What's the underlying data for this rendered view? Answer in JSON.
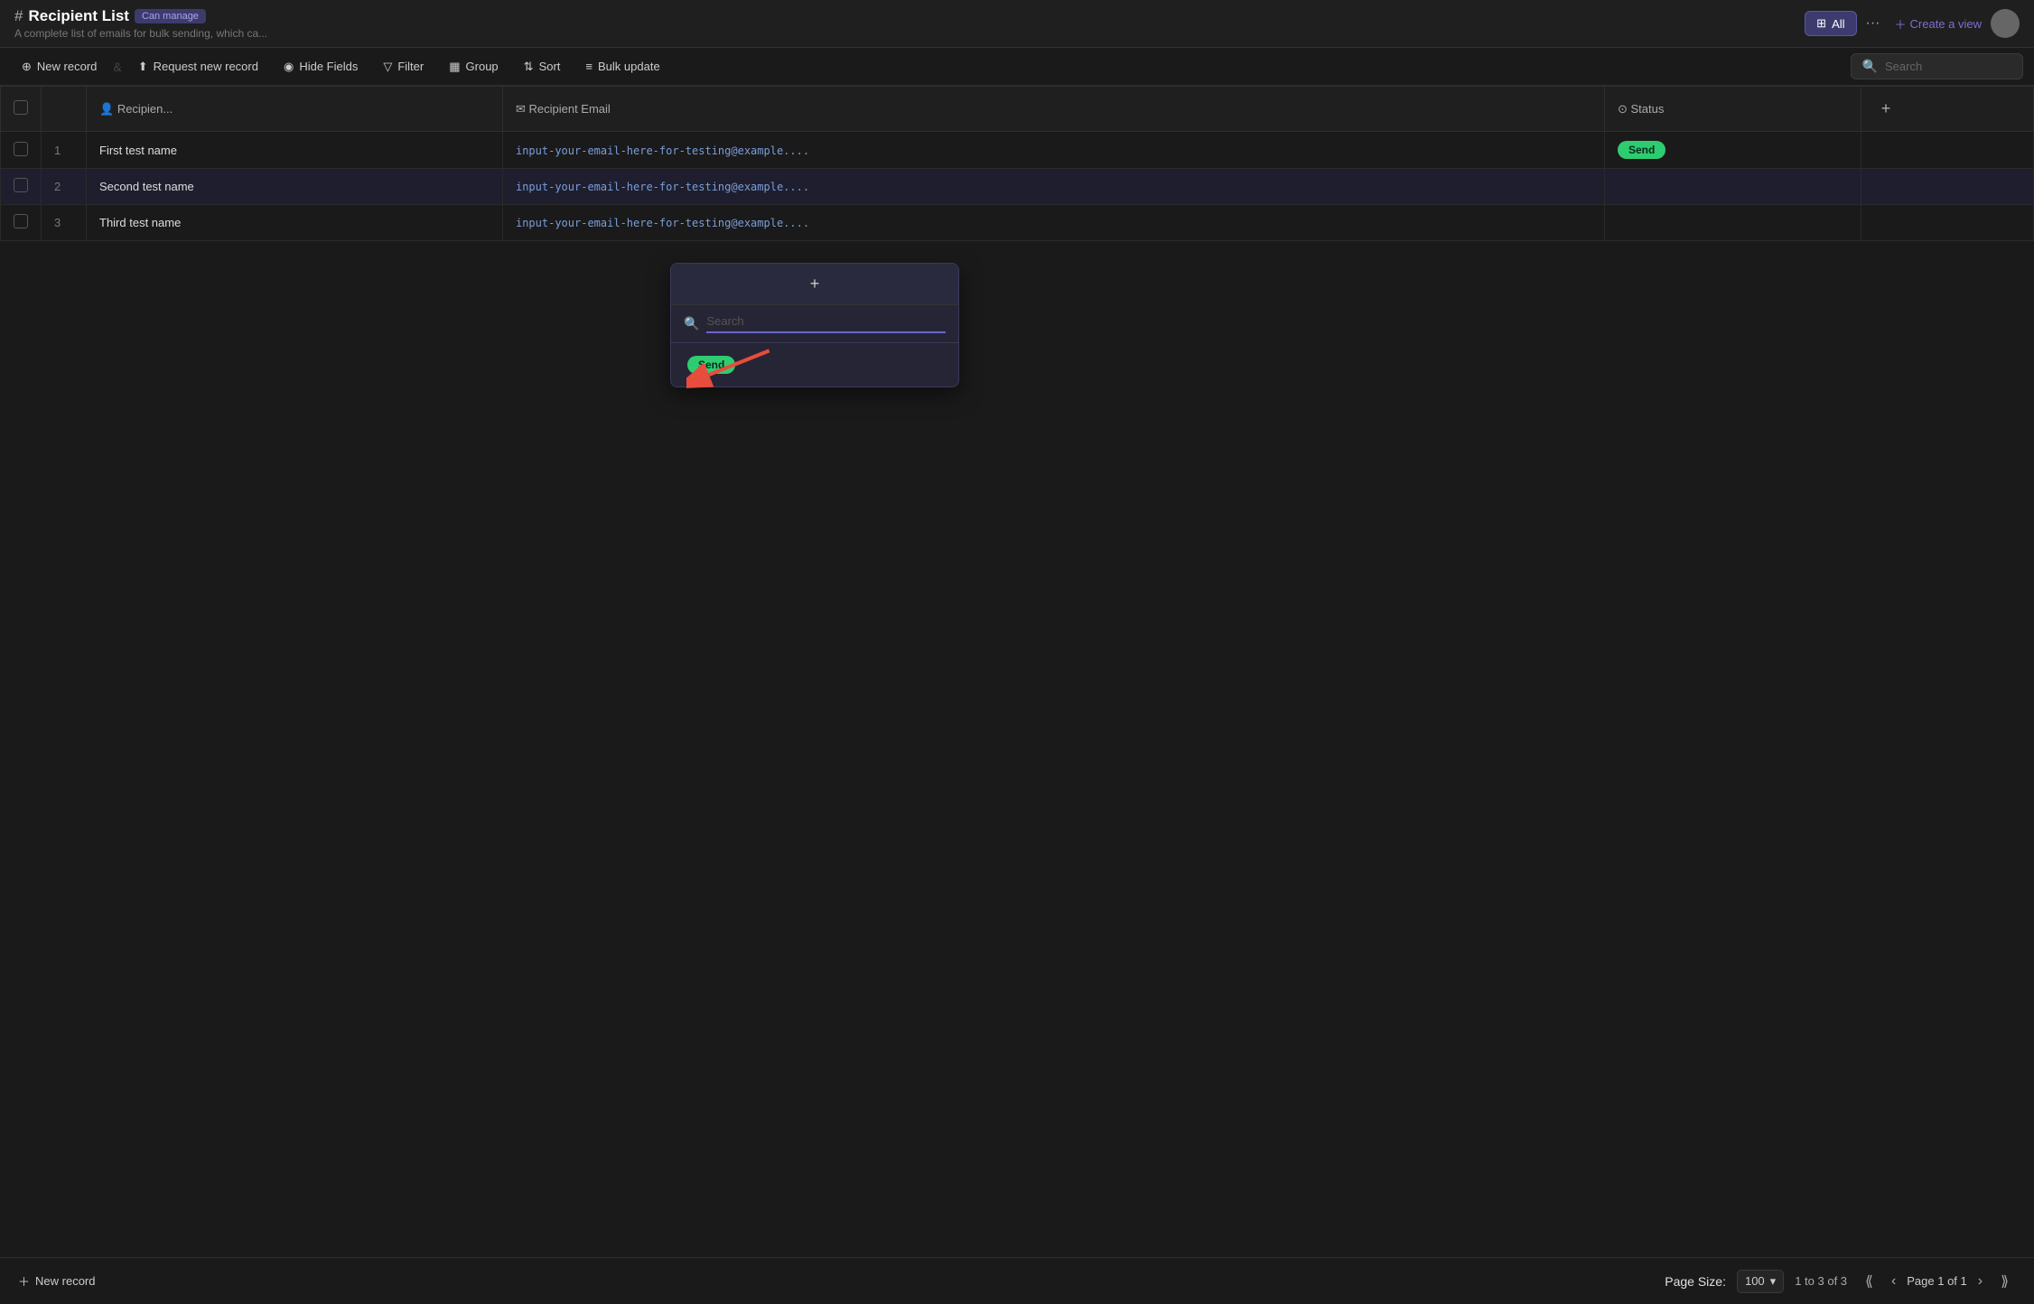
{
  "header": {
    "hash_symbol": "#",
    "title": "Recipient List",
    "badge": "Can manage",
    "subtitle": "A complete list of emails for bulk sending, which ca...",
    "view_all_label": "All",
    "view_dots_label": "···",
    "create_view_label": "Create a view"
  },
  "toolbar": {
    "new_record_label": "New record",
    "request_record_label": "Request new record",
    "hide_fields_label": "Hide Fields",
    "filter_label": "Filter",
    "group_label": "Group",
    "sort_label": "Sort",
    "bulk_update_label": "Bulk update",
    "search_placeholder": "Search"
  },
  "table": {
    "columns": [
      {
        "id": "checkbox",
        "label": ""
      },
      {
        "id": "row_num",
        "label": ""
      },
      {
        "id": "recipient_name",
        "label": "Recipien...",
        "icon": "person-icon"
      },
      {
        "id": "recipient_email",
        "label": "Recipient Email",
        "icon": "email-icon"
      },
      {
        "id": "status",
        "label": "Status",
        "icon": "clock-icon"
      },
      {
        "id": "add_col",
        "label": "+"
      }
    ],
    "rows": [
      {
        "id": 1,
        "num": "1",
        "name": "First test name",
        "email": "input-your-email-here-for-testing@example....",
        "status": "Send"
      },
      {
        "id": 2,
        "num": "2",
        "name": "Second test name",
        "email": "input-your-email-here-for-testing@example....",
        "status": null
      },
      {
        "id": 3,
        "num": "3",
        "name": "Third test name",
        "email": "input-your-email-here-for-testing@example....",
        "status": null
      }
    ]
  },
  "dropdown": {
    "add_label": "+",
    "search_placeholder": "Search",
    "options": [
      {
        "label": "Send",
        "color": "#2ecc71"
      }
    ]
  },
  "footer": {
    "new_record_label": "New record",
    "page_size_label": "Page Size:",
    "page_size_value": "100",
    "pagination_info": "1 to 3 of 3",
    "page_label": "Page 1 of 1"
  }
}
